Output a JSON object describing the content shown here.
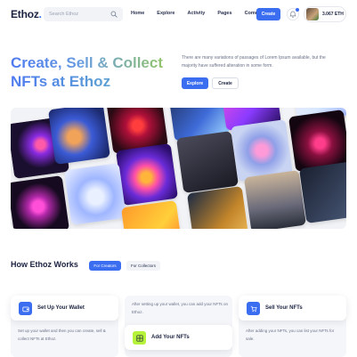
{
  "brand": {
    "name": "Ethoz",
    "dot": "."
  },
  "search": {
    "placeholder": "Search Ethoz"
  },
  "nav": {
    "links": [
      "Home",
      "Explore",
      "Activity",
      "Pages",
      "Community"
    ],
    "create_label": "Create"
  },
  "wallet": {
    "balance": "3.067 ETH"
  },
  "hero": {
    "title_line1": "Create, Sell & Collect",
    "title_line2": "NFTs at Ethoz",
    "description": "There are many variations of passages of Lorem Ipsum available, but the majority have suffered alteration in some form.",
    "explore_label": "Explore",
    "create_label": "Create"
  },
  "how": {
    "title": "How Ethoz Works",
    "tabs": [
      "For Creators",
      "For Collectors"
    ],
    "steps": [
      {
        "title": "Set Up Your Wallet",
        "desc": "Set up your wallet and then you can create, sell & collect NFTs at Ethoz."
      },
      {
        "title": "Add Your NFTs",
        "desc": "After setting up your wallet, you can add your NFTs on Ethoz."
      },
      {
        "title": "Sell Your NFTs",
        "desc": "After adding your NFTs, you can list your NFTs for sale."
      }
    ]
  },
  "colors": {
    "accent": "#3a6df0",
    "green_accent": "#b6f23a",
    "text_dark": "#1b2240"
  },
  "icons": {
    "search": "search-icon",
    "bell": "bell-icon",
    "wallet_step": "wallet-icon",
    "add_step": "grid-plus-icon",
    "sell_step": "cart-icon"
  }
}
